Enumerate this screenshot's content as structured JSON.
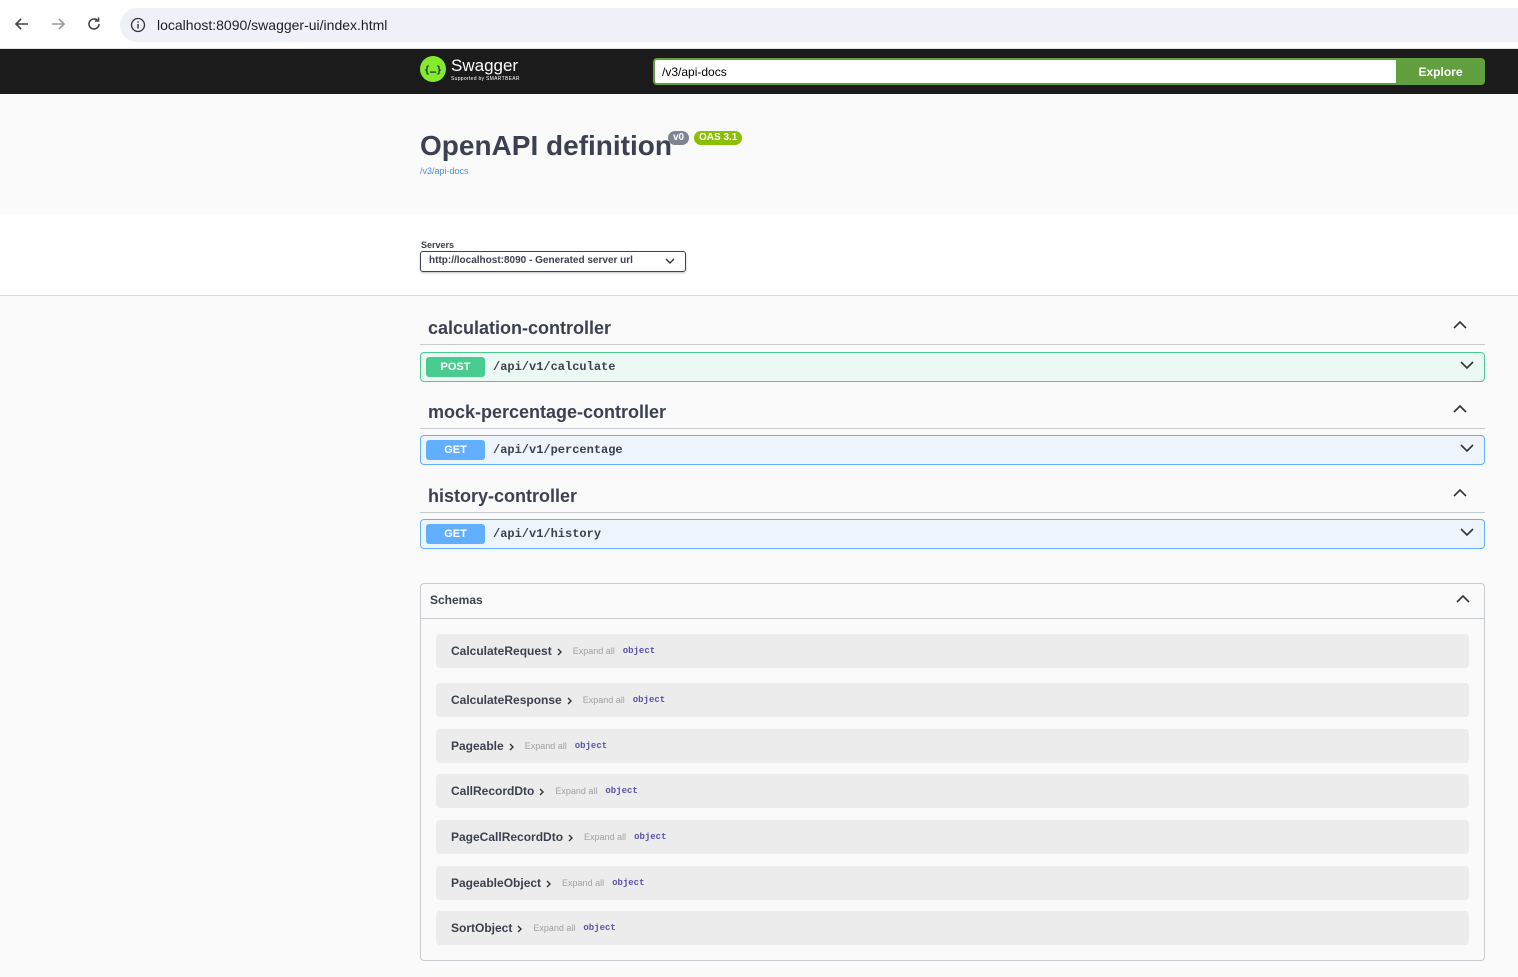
{
  "browser": {
    "url": "localhost:8090/swagger-ui/index.html"
  },
  "topbar": {
    "logo_name": "Swagger",
    "logo_sub": "Supported by SMARTBEAR",
    "spec_url": "/v3/api-docs",
    "explore_label": "Explore"
  },
  "info": {
    "title": "OpenAPI definition",
    "version_badge": "v0",
    "oas_badge": "OAS 3.1",
    "spec_link": "/v3/api-docs"
  },
  "servers": {
    "label": "Servers",
    "selected": "http://localhost:8090 - Generated server url"
  },
  "tags": [
    {
      "name": "calculation-controller",
      "method": "POST",
      "path": "/api/v1/calculate"
    },
    {
      "name": "mock-percentage-controller",
      "method": "GET",
      "path": "/api/v1/percentage"
    },
    {
      "name": "history-controller",
      "method": "GET",
      "path": "/api/v1/history"
    }
  ],
  "schemas": {
    "title": "Schemas",
    "expand_label": "Expand all",
    "type_label": "object",
    "models": [
      "CalculateRequest",
      "CalculateResponse",
      "Pageable",
      "CallRecordDto",
      "PageCallRecordDto",
      "PageableObject",
      "SortObject"
    ]
  },
  "colors": {
    "post": "#49cc90",
    "get": "#61affe",
    "explore": "#62a03f",
    "oas_badge": "#89bf04"
  }
}
